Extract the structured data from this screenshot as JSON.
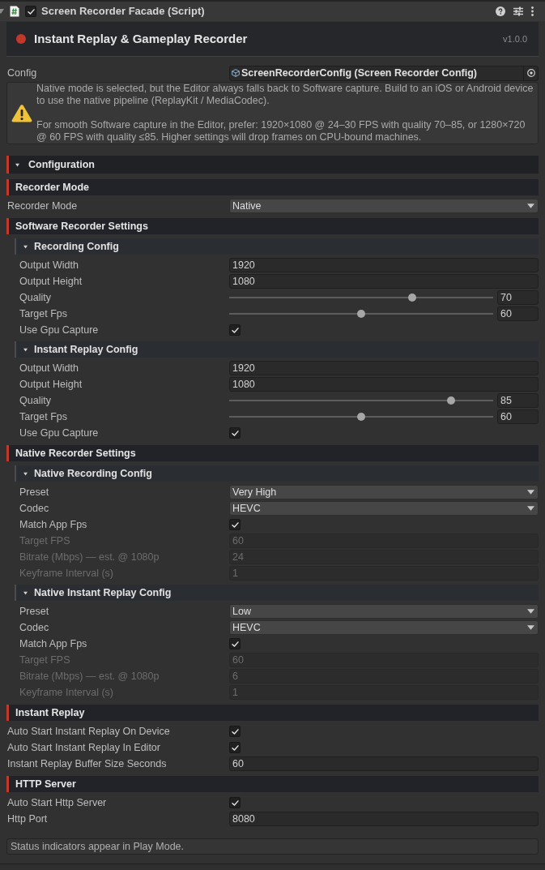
{
  "inspector_header": {
    "title": "Screen Recorder Facade (Script)",
    "enabled": true,
    "expanded": true
  },
  "banner": {
    "title": "Instant Replay & Gameplay Recorder",
    "version": "v1.0.0"
  },
  "config": {
    "label": "Config",
    "value": "ScreenRecorderConfig (Screen Recorder Config)"
  },
  "warning": {
    "paragraphs": [
      "Native mode is selected, but the Editor always falls back to Software capture. Build to an iOS or Android device to use the native pipeline (ReplayKit / MediaCodec).",
      "For smooth Software capture in the Editor, prefer: 1920×1080 @ 24–30 FPS with quality 70–85, or 1280×720 @ 60 FPS with quality ≤85. Higher settings will drop frames on CPU-bound machines."
    ]
  },
  "foldout": {
    "label": "Configuration",
    "expanded": true
  },
  "sections": [
    {
      "title": "Recorder Mode",
      "rows": [
        {
          "kind": "dropdown",
          "label": "Recorder Mode",
          "value": "Native",
          "disabled": false
        }
      ]
    },
    {
      "title": "Software Recorder Settings",
      "groups": [
        {
          "title": "Recording Config",
          "expanded": true,
          "rows": [
            {
              "kind": "text",
              "label": "Output Width",
              "value": "1920",
              "disabled": false
            },
            {
              "kind": "text",
              "label": "Output Height",
              "value": "1080",
              "disabled": false
            },
            {
              "kind": "slider",
              "label": "Quality",
              "level": 0.7,
              "value": "70",
              "disabled": false
            },
            {
              "kind": "slider",
              "label": "Target Fps",
              "level": 0.5,
              "value": "60",
              "disabled": false
            },
            {
              "kind": "toggle",
              "label": "Use Gpu Capture",
              "checked": true,
              "disabled": false
            }
          ]
        },
        {
          "title": "Instant Replay Config",
          "expanded": true,
          "rows": [
            {
              "kind": "text",
              "label": "Output Width",
              "value": "1920",
              "disabled": false
            },
            {
              "kind": "text",
              "label": "Output Height",
              "value": "1080",
              "disabled": false
            },
            {
              "kind": "slider",
              "label": "Quality",
              "level": 0.85,
              "value": "85",
              "disabled": false
            },
            {
              "kind": "slider",
              "label": "Target Fps",
              "level": 0.5,
              "value": "60",
              "disabled": false
            },
            {
              "kind": "toggle",
              "label": "Use Gpu Capture",
              "checked": true,
              "disabled": false
            }
          ]
        }
      ]
    },
    {
      "title": "Native Recorder Settings",
      "groups": [
        {
          "title": "Native Recording Config",
          "expanded": true,
          "rows": [
            {
              "kind": "dropdown",
              "label": "Preset",
              "value": "Very High",
              "disabled": false
            },
            {
              "kind": "dropdown",
              "label": "Codec",
              "value": "HEVC",
              "disabled": false
            },
            {
              "kind": "toggle",
              "label": "Match App Fps",
              "checked": true,
              "disabled": false
            },
            {
              "kind": "text",
              "label": "Target FPS",
              "value": "60",
              "disabled": true
            },
            {
              "kind": "text",
              "label": "Bitrate (Mbps) — est. @ 1080p",
              "value": "24",
              "disabled": true
            },
            {
              "kind": "text",
              "label": "Keyframe Interval (s)",
              "value": "1",
              "disabled": true
            }
          ]
        },
        {
          "title": "Native Instant Replay Config",
          "expanded": true,
          "rows": [
            {
              "kind": "dropdown",
              "label": "Preset",
              "value": "Low",
              "disabled": false
            },
            {
              "kind": "dropdown",
              "label": "Codec",
              "value": "HEVC",
              "disabled": false
            },
            {
              "kind": "toggle",
              "label": "Match App Fps",
              "checked": true,
              "disabled": false
            },
            {
              "kind": "text",
              "label": "Target FPS",
              "value": "60",
              "disabled": true
            },
            {
              "kind": "text",
              "label": "Bitrate (Mbps) — est. @ 1080p",
              "value": "6",
              "disabled": true
            },
            {
              "kind": "text",
              "label": "Keyframe Interval (s)",
              "value": "1",
              "disabled": true
            }
          ]
        }
      ]
    },
    {
      "title": "Instant Replay",
      "rows": [
        {
          "kind": "toggle",
          "label": "Auto Start Instant Replay On Device",
          "checked": true,
          "disabled": false
        },
        {
          "kind": "toggle",
          "label": "Auto Start Instant Replay In Editor",
          "checked": true,
          "disabled": false
        },
        {
          "kind": "text",
          "label": "Instant Replay Buffer Size Seconds",
          "value": "60",
          "disabled": false
        }
      ]
    },
    {
      "title": "HTTP Server",
      "rows": [
        {
          "kind": "toggle",
          "label": "Auto Start Http Server",
          "checked": true,
          "disabled": false
        },
        {
          "kind": "text",
          "label": "Http Port",
          "value": "8080",
          "disabled": false
        }
      ]
    }
  ],
  "status_message": "Status indicators appear in Play Mode."
}
